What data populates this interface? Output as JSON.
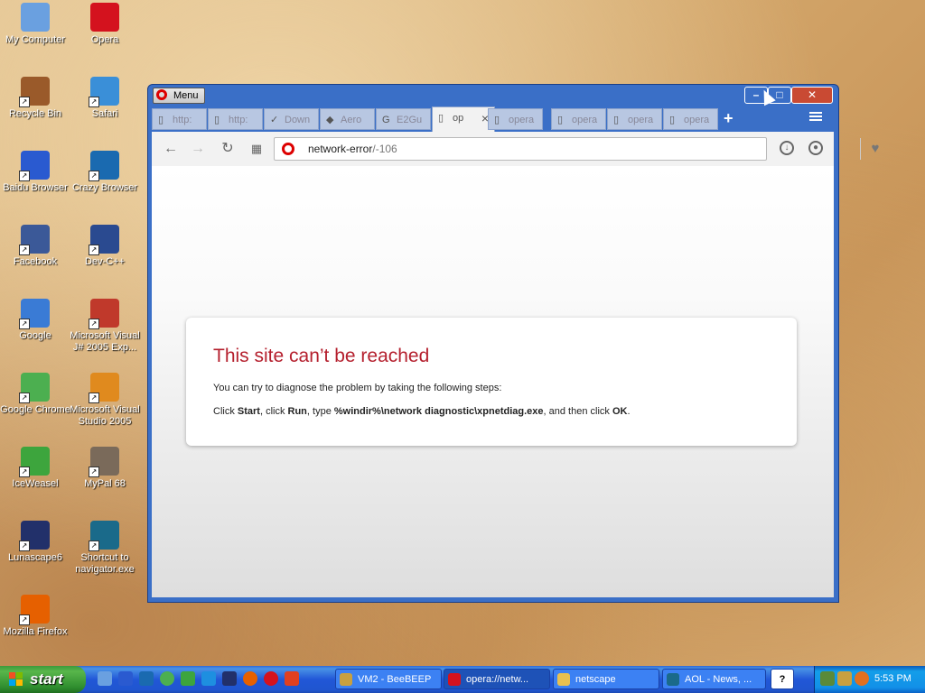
{
  "desktop": {
    "icons": [
      {
        "label": "My Computer",
        "icon": "my-computer-icon",
        "color": "#6aa0e0"
      },
      {
        "label": "Opera",
        "icon": "opera-icon",
        "color": "#d4121e"
      },
      {
        "label": "Recycle Bin",
        "icon": "recycle-bin-icon",
        "color": "#9a5a2a"
      },
      {
        "label": "Safari",
        "icon": "safari-icon",
        "color": "#3a8fd8"
      },
      {
        "label": "Baidu Browser",
        "icon": "baidu-browser-icon",
        "color": "#2a5ad0"
      },
      {
        "label": "Crazy Browser",
        "icon": "crazy-browser-icon",
        "color": "#1a6ab0"
      },
      {
        "label": "Facebook",
        "icon": "facebook-icon",
        "color": "#3b5998"
      },
      {
        "label": "Dev-C++",
        "icon": "dev-cpp-icon",
        "color": "#2a4a90"
      },
      {
        "label": "Google",
        "icon": "google-icon",
        "color": "#3a7bd5"
      },
      {
        "label": "Microsoft Visual J# 2005 Exp...",
        "icon": "visual-j-sharp-icon",
        "color": "#c0392b"
      },
      {
        "label": "Google Chrome",
        "icon": "google-chrome-icon",
        "color": "#4caf50"
      },
      {
        "label": "Microsoft Visual Studio 2005",
        "icon": "visual-studio-icon",
        "color": "#e08a1e"
      },
      {
        "label": "IceWeasel",
        "icon": "iceweasel-icon",
        "color": "#3da53d"
      },
      {
        "label": "MyPal 68",
        "icon": "mypal-icon",
        "color": "#7a6a5a"
      },
      {
        "label": "Lunascape6",
        "icon": "lunascape-icon",
        "color": "#22306a"
      },
      {
        "label": "Shortcut to navigator.exe",
        "icon": "netscape-navigator-icon",
        "color": "#1a6a8a"
      },
      {
        "label": "Mozilla Firefox",
        "icon": "firefox-icon",
        "color": "#e66000"
      }
    ]
  },
  "browser": {
    "menu_label": "Menu",
    "tabs": [
      {
        "label": "http:",
        "icon": "page-icon"
      },
      {
        "label": "http:",
        "icon": "page-icon"
      },
      {
        "label": "Down",
        "icon": "download-site-icon"
      },
      {
        "label": "Aero",
        "icon": "aero-site-icon"
      },
      {
        "label": "E2Gu",
        "icon": "google-g-icon"
      },
      {
        "label": "op",
        "icon": "page-icon"
      },
      {
        "label": "opera",
        "icon": "page-icon"
      },
      {
        "label": "opera",
        "icon": "page-icon"
      },
      {
        "label": "opera",
        "icon": "page-icon"
      },
      {
        "label": "opera",
        "icon": "page-icon"
      }
    ],
    "active_tab_close": "×",
    "new_tab": "+",
    "address": {
      "main": "network-error",
      "rest": "/-106"
    },
    "error": {
      "title": "This site can’t be reached",
      "subtitle": "You can try to diagnose the problem by taking the following steps:",
      "steps": [
        {
          "t": "Click ",
          "b": false
        },
        {
          "t": "Start",
          "b": true
        },
        {
          "t": ", click ",
          "b": false
        },
        {
          "t": "Run",
          "b": true
        },
        {
          "t": ", type ",
          "b": false
        },
        {
          "t": "%windir%\\network diagnostic\\xpnetdiag.exe",
          "b": true
        },
        {
          "t": ", and then click ",
          "b": false
        },
        {
          "t": "OK",
          "b": true
        },
        {
          "t": ".",
          "b": false
        }
      ]
    }
  },
  "taskbar": {
    "start_label": "start",
    "tasks": [
      {
        "label": "VM2 - BeeBEEP",
        "icon": "beebeep-icon",
        "active": false
      },
      {
        "label": "opera://netw...",
        "icon": "opera-icon",
        "active": true
      },
      {
        "label": "netscape",
        "icon": "folder-icon",
        "active": false
      },
      {
        "label": "AOL - News, ...",
        "icon": "netscape-icon",
        "active": false
      }
    ],
    "help_label": "?",
    "clock": "5:53 PM"
  }
}
